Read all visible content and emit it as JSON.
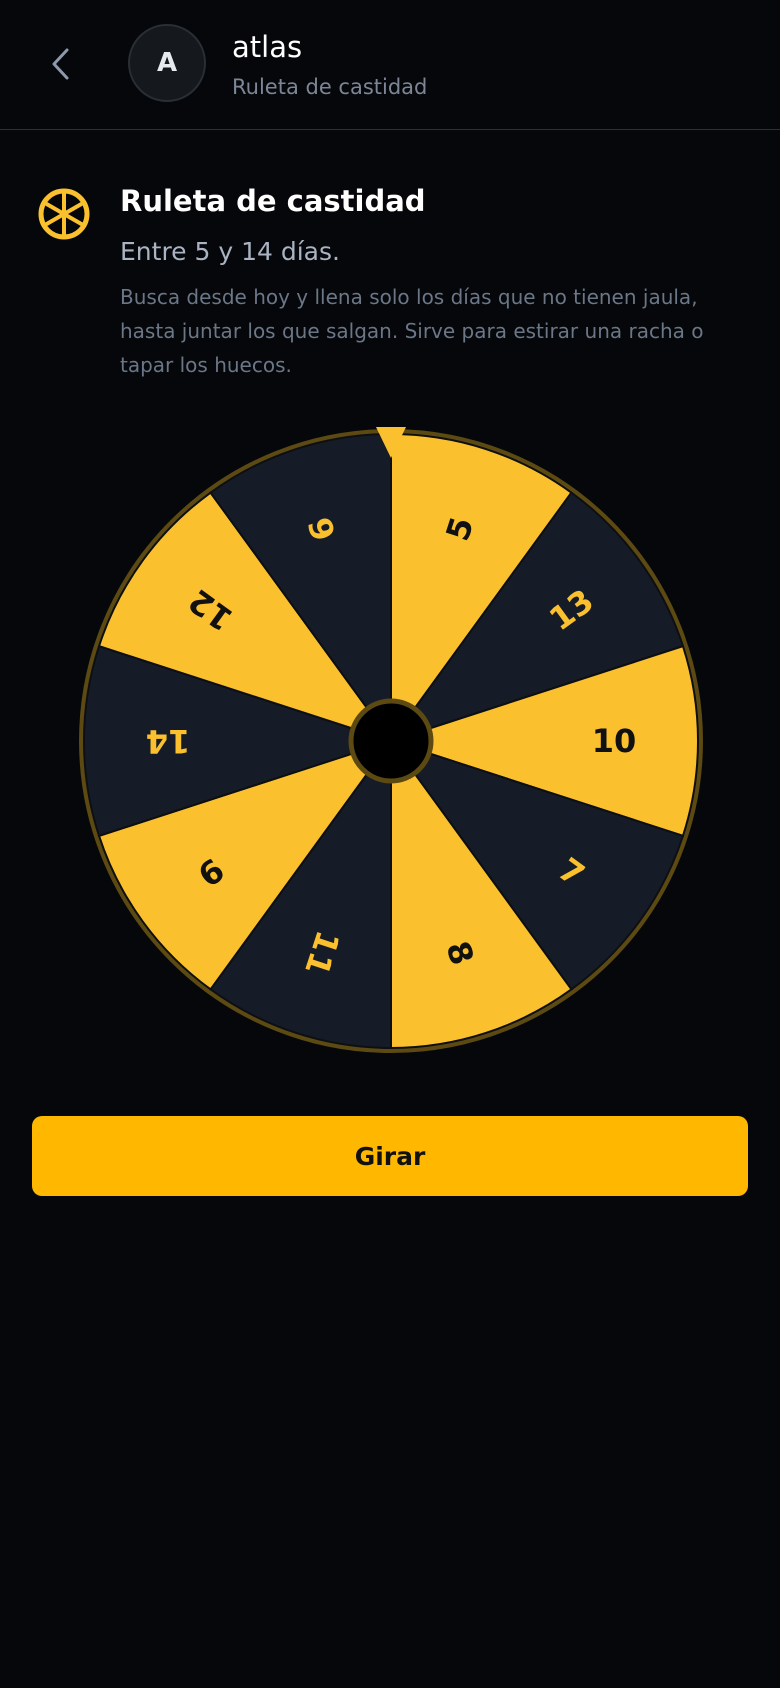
{
  "header": {
    "avatar_initial": "A",
    "title": "atlas",
    "subtitle": "Ruleta de castidad"
  },
  "section": {
    "title": "Ruleta de castidad",
    "range": "Entre 5 y 14 días.",
    "description": "Busca desde hoy y llena solo los días que no tienen jaula, hasta juntar los que salgan. Sirve para estirar una racha o tapar los huecos."
  },
  "wheel": {
    "segments": [
      "5",
      "13",
      "10",
      "7",
      "8",
      "11",
      "9",
      "14",
      "12",
      "6"
    ],
    "colors": {
      "yellow": "#fbc02d",
      "dark": "#161c27",
      "rim": "#5c4a12",
      "hub": "#000000"
    }
  },
  "actions": {
    "spin_label": "Girar"
  },
  "colors": {
    "background": "#05070a",
    "accent": "#ffb700",
    "icon_accent": "#fbc02d"
  }
}
